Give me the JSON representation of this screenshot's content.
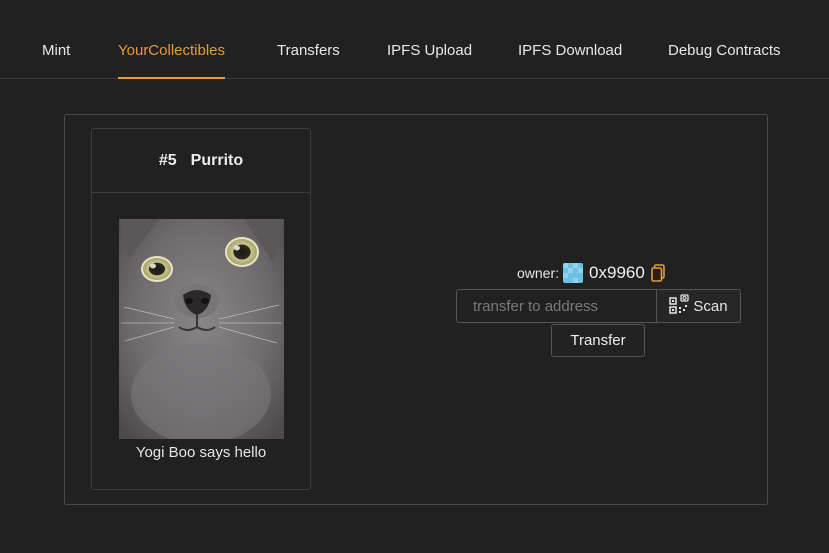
{
  "nav": {
    "tabs": [
      {
        "label": "Mint"
      },
      {
        "label": "YourCollectibles"
      },
      {
        "label": "Transfers"
      },
      {
        "label": "IPFS Upload"
      },
      {
        "label": "IPFS Download"
      },
      {
        "label": "Debug Contracts"
      }
    ],
    "active_tab": "YourCollectibles"
  },
  "collectible": {
    "id": "#5",
    "name": "Purrito",
    "description": "Yogi Boo says hello"
  },
  "owner": {
    "label": "owner:",
    "address": "0x9960",
    "avatar_icon": "blockie-avatar",
    "copy_icon": "copy-icon"
  },
  "transfer": {
    "placeholder": "transfer to address",
    "scan_label": "Scan",
    "button_label": "Transfer"
  },
  "colors": {
    "accent": "#e89a3c",
    "background": "#212121"
  }
}
